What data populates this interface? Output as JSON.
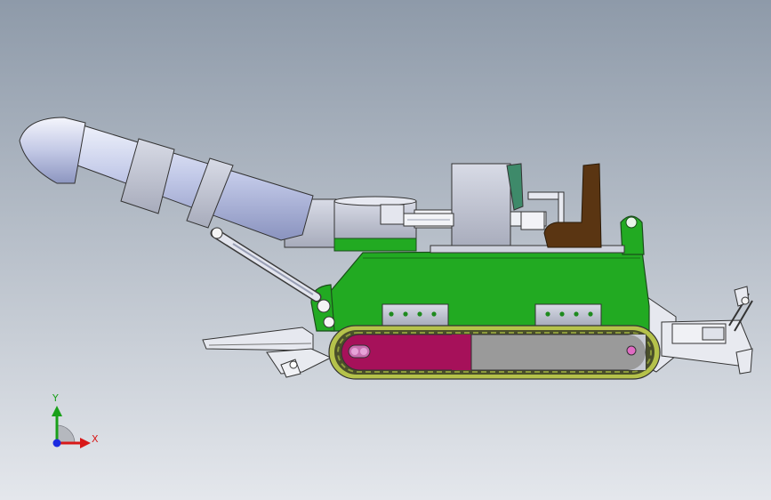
{
  "viewport": {
    "background_top": "#8e9aa9",
    "background_bottom": "#e4e7ec"
  },
  "model": {
    "body_color": "#22aa22",
    "track_pad_color": "#b5c24b",
    "track_front_color": "#a6115a",
    "track_rear_color": "#9a9a9a",
    "seat_color": "#5a3512",
    "boom_color": "#b9c2e4",
    "cutter_color": "#c7cdea"
  },
  "triad": {
    "x_label": "X",
    "y_label": "Y",
    "x_color": "#d81818",
    "y_color": "#19a019",
    "z_color": "#1c2be0"
  }
}
